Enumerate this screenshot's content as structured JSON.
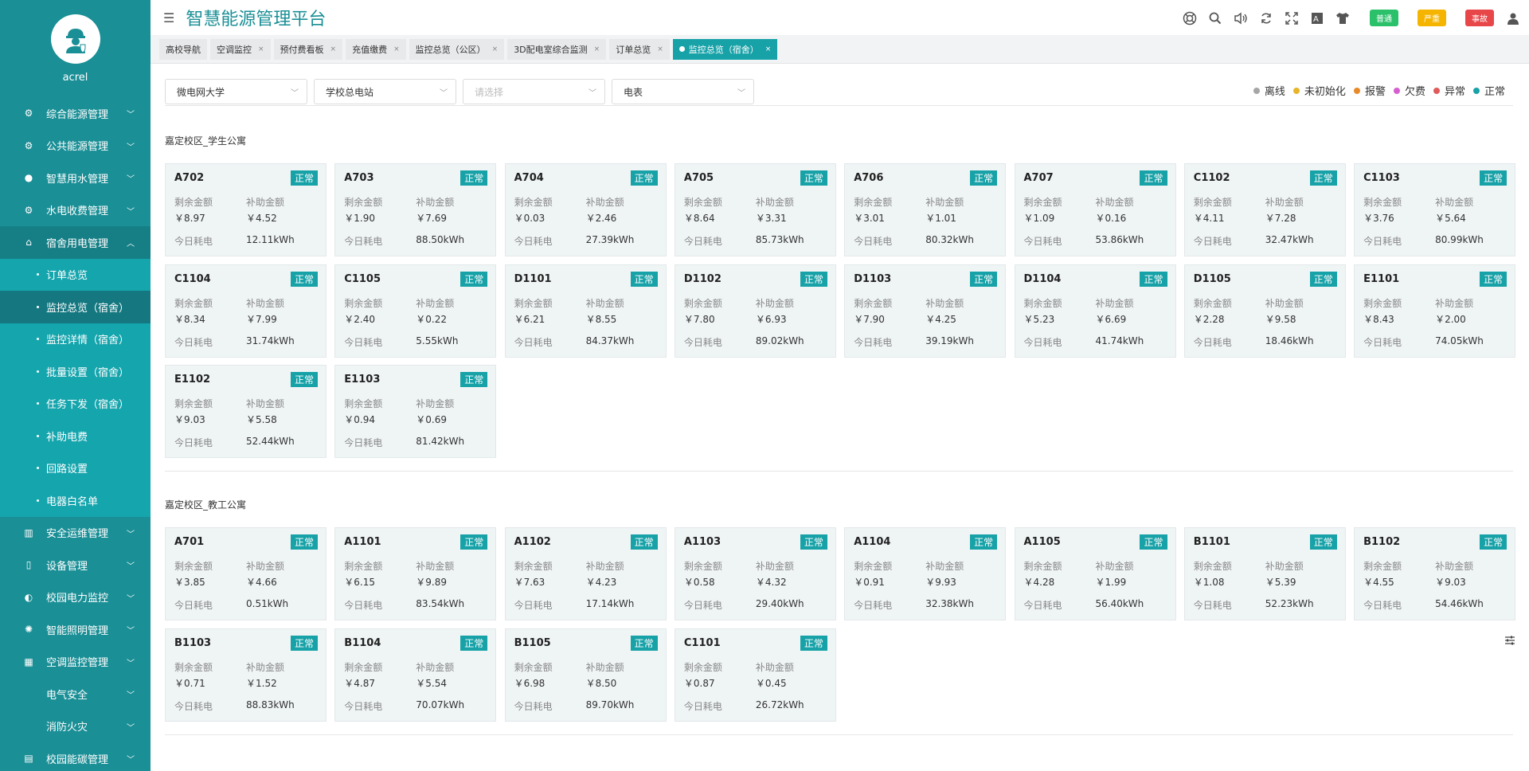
{
  "sidebar": {
    "username": "acrel",
    "menu_top": [
      {
        "label": "综合能源管理",
        "icon": "energy-icon"
      },
      {
        "label": "公共能源管理",
        "icon": "public-energy-icon"
      },
      {
        "label": "智慧用水管理",
        "icon": "water-drop-icon"
      },
      {
        "label": "水电收费管理",
        "icon": "billing-icon"
      },
      {
        "label": "宿舍用电管理",
        "icon": "dorm-power-icon"
      }
    ],
    "sub_items": [
      {
        "label": "订单总览",
        "active": false
      },
      {
        "label": "监控总览（宿舍）",
        "active": true
      },
      {
        "label": "监控详情（宿舍）",
        "active": false
      },
      {
        "label": "批量设置（宿舍）",
        "active": false
      },
      {
        "label": "任务下发（宿舍）",
        "active": false
      },
      {
        "label": "补助电费",
        "active": false
      },
      {
        "label": "回路设置",
        "active": false
      },
      {
        "label": "电器白名单",
        "active": false
      }
    ],
    "menu_bottom_1": [
      {
        "label": "安全运维管理",
        "icon": "ops-icon"
      },
      {
        "label": "设备管理",
        "icon": "device-icon"
      },
      {
        "label": "校园电力监控",
        "icon": "power-monitor-icon"
      },
      {
        "label": "智能照明管理",
        "icon": "lighting-icon"
      },
      {
        "label": "空调监控管理",
        "icon": "ac-icon"
      }
    ],
    "plain_subs": [
      {
        "label": "电气安全"
      },
      {
        "label": "消防火灾"
      }
    ],
    "menu_bottom_2": [
      {
        "label": "校园能碳管理",
        "icon": "carbon-icon"
      }
    ]
  },
  "header": {
    "title": "智慧能源管理平台",
    "badges": [
      {
        "label": "普通",
        "color": "#2bc16b"
      },
      {
        "label": "严重",
        "color": "#f5b400"
      },
      {
        "label": "事故",
        "color": "#e8474a"
      }
    ]
  },
  "tabs": [
    {
      "label": "高校导航",
      "closable": false,
      "active": false
    },
    {
      "label": "空调监控",
      "closable": true,
      "active": false
    },
    {
      "label": "预付费看板",
      "closable": true,
      "active": false
    },
    {
      "label": "充值缴费",
      "closable": true,
      "active": false
    },
    {
      "label": "监控总览（公区）",
      "closable": true,
      "active": false
    },
    {
      "label": "3D配电室综合监测",
      "closable": true,
      "active": false
    },
    {
      "label": "订单总览",
      "closable": true,
      "active": false
    },
    {
      "label": "监控总览（宿舍）",
      "closable": true,
      "active": true
    }
  ],
  "filters": [
    {
      "value": "微电网大学",
      "placeholder": false
    },
    {
      "value": "学校总电站",
      "placeholder": false
    },
    {
      "value": "请选择",
      "placeholder": true
    },
    {
      "value": "电表",
      "placeholder": false
    }
  ],
  "legend": [
    {
      "label": "离线",
      "color": "#a6a6a6"
    },
    {
      "label": "未初始化",
      "color": "#e8b52a"
    },
    {
      "label": "报警",
      "color": "#e88a2a"
    },
    {
      "label": "欠费",
      "color": "#d65fd0"
    },
    {
      "label": "异常",
      "color": "#e05a5a"
    },
    {
      "label": "正常",
      "color": "#17a2a8"
    }
  ],
  "labels": {
    "remaining": "剩余金额",
    "subsidy": "补助金额",
    "today": "今日耗电"
  },
  "sections": [
    {
      "title": "嘉定校区_学生公寓",
      "rooms": [
        {
          "name": "A702",
          "status": "正常",
          "remaining": "￥8.97",
          "subsidy": "￥4.52",
          "today": "12.11kWh"
        },
        {
          "name": "A703",
          "status": "正常",
          "remaining": "￥1.90",
          "subsidy": "￥7.69",
          "today": "88.50kWh"
        },
        {
          "name": "A704",
          "status": "正常",
          "remaining": "￥0.03",
          "subsidy": "￥2.46",
          "today": "27.39kWh"
        },
        {
          "name": "A705",
          "status": "正常",
          "remaining": "￥8.64",
          "subsidy": "￥3.31",
          "today": "85.73kWh"
        },
        {
          "name": "A706",
          "status": "正常",
          "remaining": "￥3.01",
          "subsidy": "￥1.01",
          "today": "80.32kWh"
        },
        {
          "name": "A707",
          "status": "正常",
          "remaining": "￥1.09",
          "subsidy": "￥0.16",
          "today": "53.86kWh"
        },
        {
          "name": "C1102",
          "status": "正常",
          "remaining": "￥4.11",
          "subsidy": "￥7.28",
          "today": "32.47kWh"
        },
        {
          "name": "C1103",
          "status": "正常",
          "remaining": "￥3.76",
          "subsidy": "￥5.64",
          "today": "80.99kWh"
        },
        {
          "name": "C1104",
          "status": "正常",
          "remaining": "￥8.34",
          "subsidy": "￥7.99",
          "today": "31.74kWh"
        },
        {
          "name": "C1105",
          "status": "正常",
          "remaining": "￥2.40",
          "subsidy": "￥0.22",
          "today": "5.55kWh"
        },
        {
          "name": "D1101",
          "status": "正常",
          "remaining": "￥6.21",
          "subsidy": "￥8.55",
          "today": "84.37kWh"
        },
        {
          "name": "D1102",
          "status": "正常",
          "remaining": "￥7.80",
          "subsidy": "￥6.93",
          "today": "89.02kWh"
        },
        {
          "name": "D1103",
          "status": "正常",
          "remaining": "￥7.90",
          "subsidy": "￥4.25",
          "today": "39.19kWh"
        },
        {
          "name": "D1104",
          "status": "正常",
          "remaining": "￥5.23",
          "subsidy": "￥6.69",
          "today": "41.74kWh"
        },
        {
          "name": "D1105",
          "status": "正常",
          "remaining": "￥2.28",
          "subsidy": "￥9.58",
          "today": "18.46kWh"
        },
        {
          "name": "E1101",
          "status": "正常",
          "remaining": "￥8.43",
          "subsidy": "￥2.00",
          "today": "74.05kWh"
        },
        {
          "name": "E1102",
          "status": "正常",
          "remaining": "￥9.03",
          "subsidy": "￥5.58",
          "today": "52.44kWh"
        },
        {
          "name": "E1103",
          "status": "正常",
          "remaining": "￥0.94",
          "subsidy": "￥0.69",
          "today": "81.42kWh"
        }
      ]
    },
    {
      "title": "嘉定校区_教工公寓",
      "rooms": [
        {
          "name": "A701",
          "status": "正常",
          "remaining": "￥3.85",
          "subsidy": "￥4.66",
          "today": "0.51kWh"
        },
        {
          "name": "A1101",
          "status": "正常",
          "remaining": "￥6.15",
          "subsidy": "￥9.89",
          "today": "83.54kWh"
        },
        {
          "name": "A1102",
          "status": "正常",
          "remaining": "￥7.63",
          "subsidy": "￥4.23",
          "today": "17.14kWh"
        },
        {
          "name": "A1103",
          "status": "正常",
          "remaining": "￥0.58",
          "subsidy": "￥4.32",
          "today": "29.40kWh"
        },
        {
          "name": "A1104",
          "status": "正常",
          "remaining": "￥0.91",
          "subsidy": "￥9.93",
          "today": "32.38kWh"
        },
        {
          "name": "A1105",
          "status": "正常",
          "remaining": "￥4.28",
          "subsidy": "￥1.99",
          "today": "56.40kWh"
        },
        {
          "name": "B1101",
          "status": "正常",
          "remaining": "￥1.08",
          "subsidy": "￥5.39",
          "today": "52.23kWh"
        },
        {
          "name": "B1102",
          "status": "正常",
          "remaining": "￥4.55",
          "subsidy": "￥9.03",
          "today": "54.46kWh"
        },
        {
          "name": "B1103",
          "status": "正常",
          "remaining": "￥0.71",
          "subsidy": "￥1.52",
          "today": "88.83kWh"
        },
        {
          "name": "B1104",
          "status": "正常",
          "remaining": "￥4.87",
          "subsidy": "￥5.54",
          "today": "70.07kWh"
        },
        {
          "name": "B1105",
          "status": "正常",
          "remaining": "￥6.98",
          "subsidy": "￥8.50",
          "today": "89.70kWh"
        },
        {
          "name": "C1101",
          "status": "正常",
          "remaining": "￥0.87",
          "subsidy": "￥0.45",
          "today": "26.72kWh"
        }
      ]
    }
  ]
}
